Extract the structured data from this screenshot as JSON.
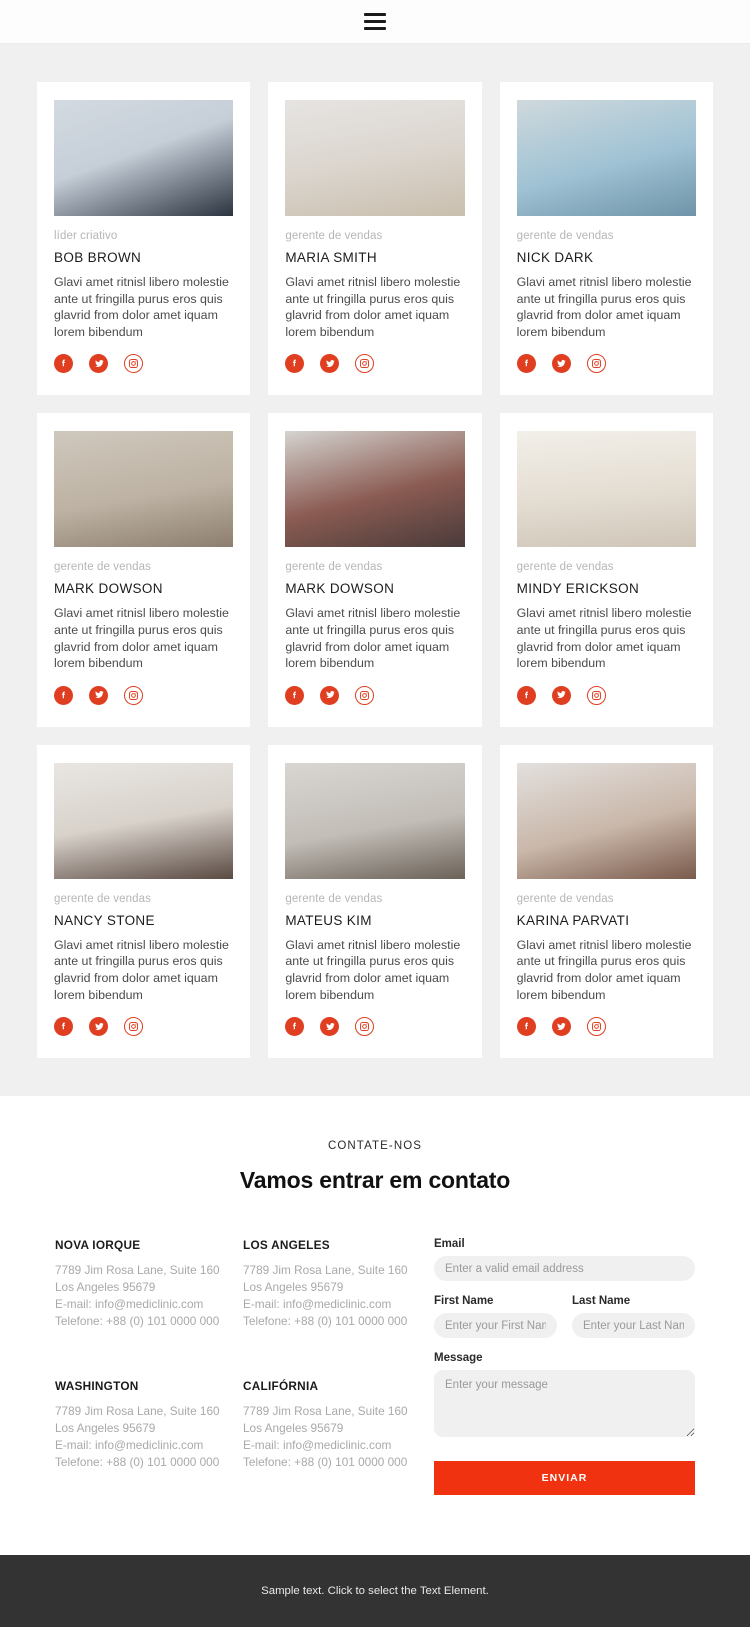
{
  "header": {
    "menu_icon": "hamburger-menu-icon"
  },
  "team": {
    "members": [
      {
        "role": "líder criativo",
        "name": "BOB BROWN",
        "desc": "Glavi amet ritnisl libero molestie ante ut fringilla purus eros quis glavrid from dolor amet iquam lorem bibendum",
        "photo": "portrait-man-suit"
      },
      {
        "role": "gerente de vendas",
        "name": "MARIA SMITH",
        "desc": "Glavi amet ritnisl libero molestie ante ut fringilla purus eros quis glavrid from dolor amet iquam lorem bibendum",
        "photo": "portrait-blonde-woman"
      },
      {
        "role": "gerente de vendas",
        "name": "NICK DARK",
        "desc": "Glavi amet ritnisl libero molestie ante ut fringilla purus eros quis glavrid from dolor amet iquam lorem bibendum",
        "photo": "portrait-bearded-man"
      },
      {
        "role": "gerente de vendas",
        "name": "MARK DOWSON",
        "desc": "Glavi amet ritnisl libero molestie ante ut fringilla purus eros quis glavrid from dolor amet iquam lorem bibendum",
        "photo": "portrait-young-man-hoodie"
      },
      {
        "role": "gerente de vendas",
        "name": "MARK DOWSON",
        "desc": "Glavi amet ritnisl libero molestie ante ut fringilla purus eros quis glavrid from dolor amet iquam lorem bibendum",
        "photo": "portrait-man-plaid-shirt"
      },
      {
        "role": "gerente de vendas",
        "name": "MINDY ERICKSON",
        "desc": "Glavi amet ritnisl libero molestie ante ut fringilla purus eros quis glavrid from dolor amet iquam lorem bibendum",
        "photo": "woman-at-desk-office"
      },
      {
        "role": "gerente de vendas",
        "name": "NANCY STONE",
        "desc": "Glavi amet ritnisl libero molestie ante ut fringilla purus eros quis glavrid from dolor amet iquam lorem bibendum",
        "photo": "portrait-woman-glasses-curly-hair"
      },
      {
        "role": "gerente de vendas",
        "name": "MATEUS KIM",
        "desc": "Glavi amet ritnisl libero molestie ante ut fringilla purus eros quis glavrid from dolor amet iquam lorem bibendum",
        "photo": "portrait-smiling-man-grey-shirt"
      },
      {
        "role": "gerente de vendas",
        "name": "KARINA PARVATI",
        "desc": "Glavi amet ritnisl libero molestie ante ut fringilla purus eros quis glavrid from dolor amet iquam lorem bibendum",
        "photo": "portrait-brunette-woman"
      }
    ],
    "social_links": [
      {
        "icon": "facebook-icon",
        "style": "filled"
      },
      {
        "icon": "twitter-icon",
        "style": "filled"
      },
      {
        "icon": "instagram-icon",
        "style": "outline"
      }
    ]
  },
  "contact": {
    "eyebrow": "CONTATE-NOS",
    "headline": "Vamos entrar em contato",
    "offices": [
      {
        "title": "NOVA IORQUE",
        "address": "7789 Jim Rosa Lane, Suite 160",
        "city": "Los Angeles 95679",
        "email": "E-mail: info@mediclinic.com",
        "phone": "Telefone: +88 (0) 101 0000 000"
      },
      {
        "title": "LOS ANGELES",
        "address": "7789 Jim Rosa Lane, Suite 160",
        "city": "Los Angeles 95679",
        "email": "E-mail: info@mediclinic.com",
        "phone": "Telefone: +88 (0) 101 0000 000"
      },
      {
        "title": "WASHINGTON",
        "address": "7789 Jim Rosa Lane, Suite 160",
        "city": "Los Angeles 95679",
        "email": "E-mail: info@mediclinic.com",
        "phone": "Telefone: +88 (0) 101 0000 000"
      },
      {
        "title": "CALIFÓRNIA",
        "address": "7789 Jim Rosa Lane, Suite 160",
        "city": "Los Angeles 95679",
        "email": "E-mail: info@mediclinic.com",
        "phone": "Telefone: +88 (0) 101 0000 000"
      }
    ],
    "form": {
      "email_label": "Email",
      "email_placeholder": "Enter a valid email address",
      "email_value": "",
      "first_name_label": "First Name",
      "first_name_placeholder": "Enter your First Name",
      "first_name_value": "",
      "last_name_label": "Last Name",
      "last_name_placeholder": "Enter your Last Name",
      "last_name_value": "",
      "message_label": "Message",
      "message_placeholder": "Enter your message",
      "message_value": "",
      "submit_label": "ENVIAR"
    }
  },
  "footer": {
    "text": "Sample text. Click to select the Text Element."
  },
  "colors": {
    "accent_red": "#e03e20",
    "button_red": "#f03210",
    "section_bg": "#f0f0f0",
    "footer_bg": "#333333"
  }
}
